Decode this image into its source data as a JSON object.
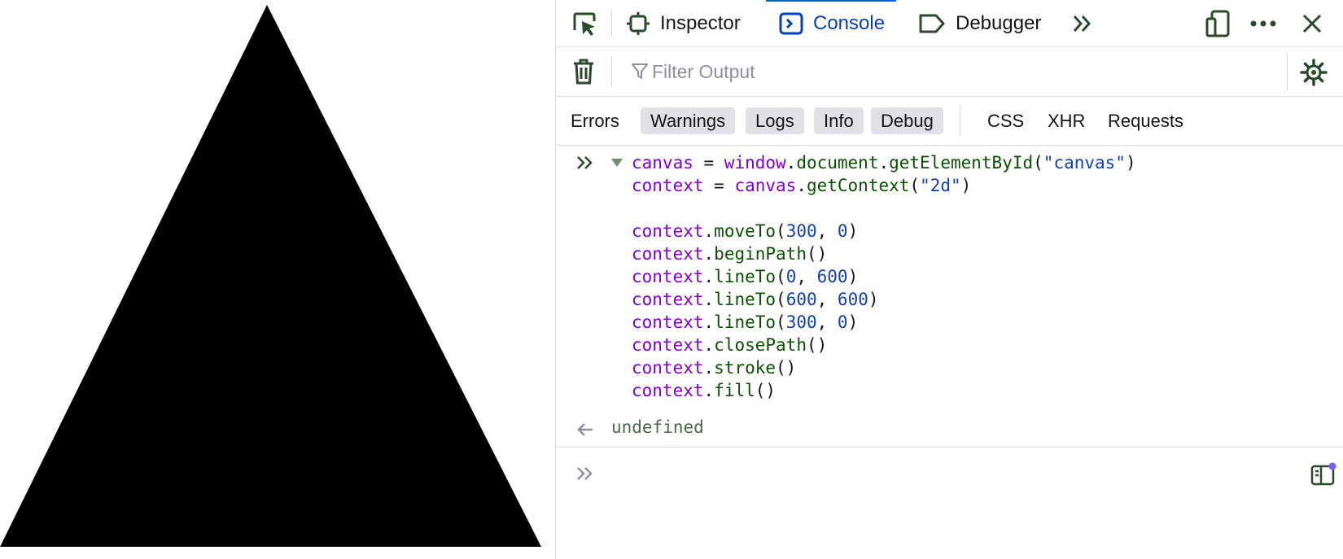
{
  "tabs": [
    {
      "label": "Inspector",
      "icon": "inspector-icon",
      "selected": false
    },
    {
      "label": "Console",
      "icon": "console-icon",
      "selected": true
    },
    {
      "label": "Debugger",
      "icon": "debugger-icon",
      "selected": false
    }
  ],
  "filter": {
    "placeholder": "Filter Output"
  },
  "levels": [
    {
      "label": "Errors",
      "on": false
    },
    {
      "label": "Warnings",
      "on": true
    },
    {
      "label": "Logs",
      "on": true
    },
    {
      "label": "Info",
      "on": true
    },
    {
      "label": "Debug",
      "on": true
    }
  ],
  "request_filters": [
    "CSS",
    "XHR",
    "Requests"
  ],
  "console": {
    "input_lines": [
      [
        [
          "canvas",
          "var"
        ],
        [
          " = ",
          "pun"
        ],
        [
          "window",
          "var"
        ],
        [
          ".",
          "pun"
        ],
        [
          "document",
          "prop"
        ],
        [
          ".",
          "pun"
        ],
        [
          "getElementById",
          "prop"
        ],
        [
          "(",
          "pun"
        ],
        [
          "\"canvas\"",
          "str"
        ],
        [
          ")",
          "pun"
        ]
      ],
      [
        [
          "context",
          "var"
        ],
        [
          " = ",
          "pun"
        ],
        [
          "canvas",
          "var"
        ],
        [
          ".",
          "pun"
        ],
        [
          "getContext",
          "prop"
        ],
        [
          "(",
          "pun"
        ],
        [
          "\"2d\"",
          "str"
        ],
        [
          ")",
          "pun"
        ]
      ],
      [],
      [
        [
          "context",
          "var"
        ],
        [
          ".",
          "pun"
        ],
        [
          "moveTo",
          "prop"
        ],
        [
          "(",
          "pun"
        ],
        [
          "300",
          "num"
        ],
        [
          ", ",
          "pun"
        ],
        [
          "0",
          "num"
        ],
        [
          ")",
          "pun"
        ]
      ],
      [
        [
          "context",
          "var"
        ],
        [
          ".",
          "pun"
        ],
        [
          "beginPath",
          "prop"
        ],
        [
          "()",
          "pun"
        ]
      ],
      [
        [
          "context",
          "var"
        ],
        [
          ".",
          "pun"
        ],
        [
          "lineTo",
          "prop"
        ],
        [
          "(",
          "pun"
        ],
        [
          "0",
          "num"
        ],
        [
          ", ",
          "pun"
        ],
        [
          "600",
          "num"
        ],
        [
          ")",
          "pun"
        ]
      ],
      [
        [
          "context",
          "var"
        ],
        [
          ".",
          "pun"
        ],
        [
          "lineTo",
          "prop"
        ],
        [
          "(",
          "pun"
        ],
        [
          "600",
          "num"
        ],
        [
          ", ",
          "pun"
        ],
        [
          "600",
          "num"
        ],
        [
          ")",
          "pun"
        ]
      ],
      [
        [
          "context",
          "var"
        ],
        [
          ".",
          "pun"
        ],
        [
          "lineTo",
          "prop"
        ],
        [
          "(",
          "pun"
        ],
        [
          "300",
          "num"
        ],
        [
          ", ",
          "pun"
        ],
        [
          "0",
          "num"
        ],
        [
          ")",
          "pun"
        ]
      ],
      [
        [
          "context",
          "var"
        ],
        [
          ".",
          "pun"
        ],
        [
          "closePath",
          "prop"
        ],
        [
          "()",
          "pun"
        ]
      ],
      [
        [
          "context",
          "var"
        ],
        [
          ".",
          "pun"
        ],
        [
          "stroke",
          "prop"
        ],
        [
          "()",
          "pun"
        ]
      ],
      [
        [
          "context",
          "var"
        ],
        [
          ".",
          "pun"
        ],
        [
          "fill",
          "prop"
        ],
        [
          "()",
          "pun"
        ]
      ]
    ],
    "result": "undefined"
  },
  "colors": {
    "accent": "#0060df",
    "triangle": "#000000"
  }
}
